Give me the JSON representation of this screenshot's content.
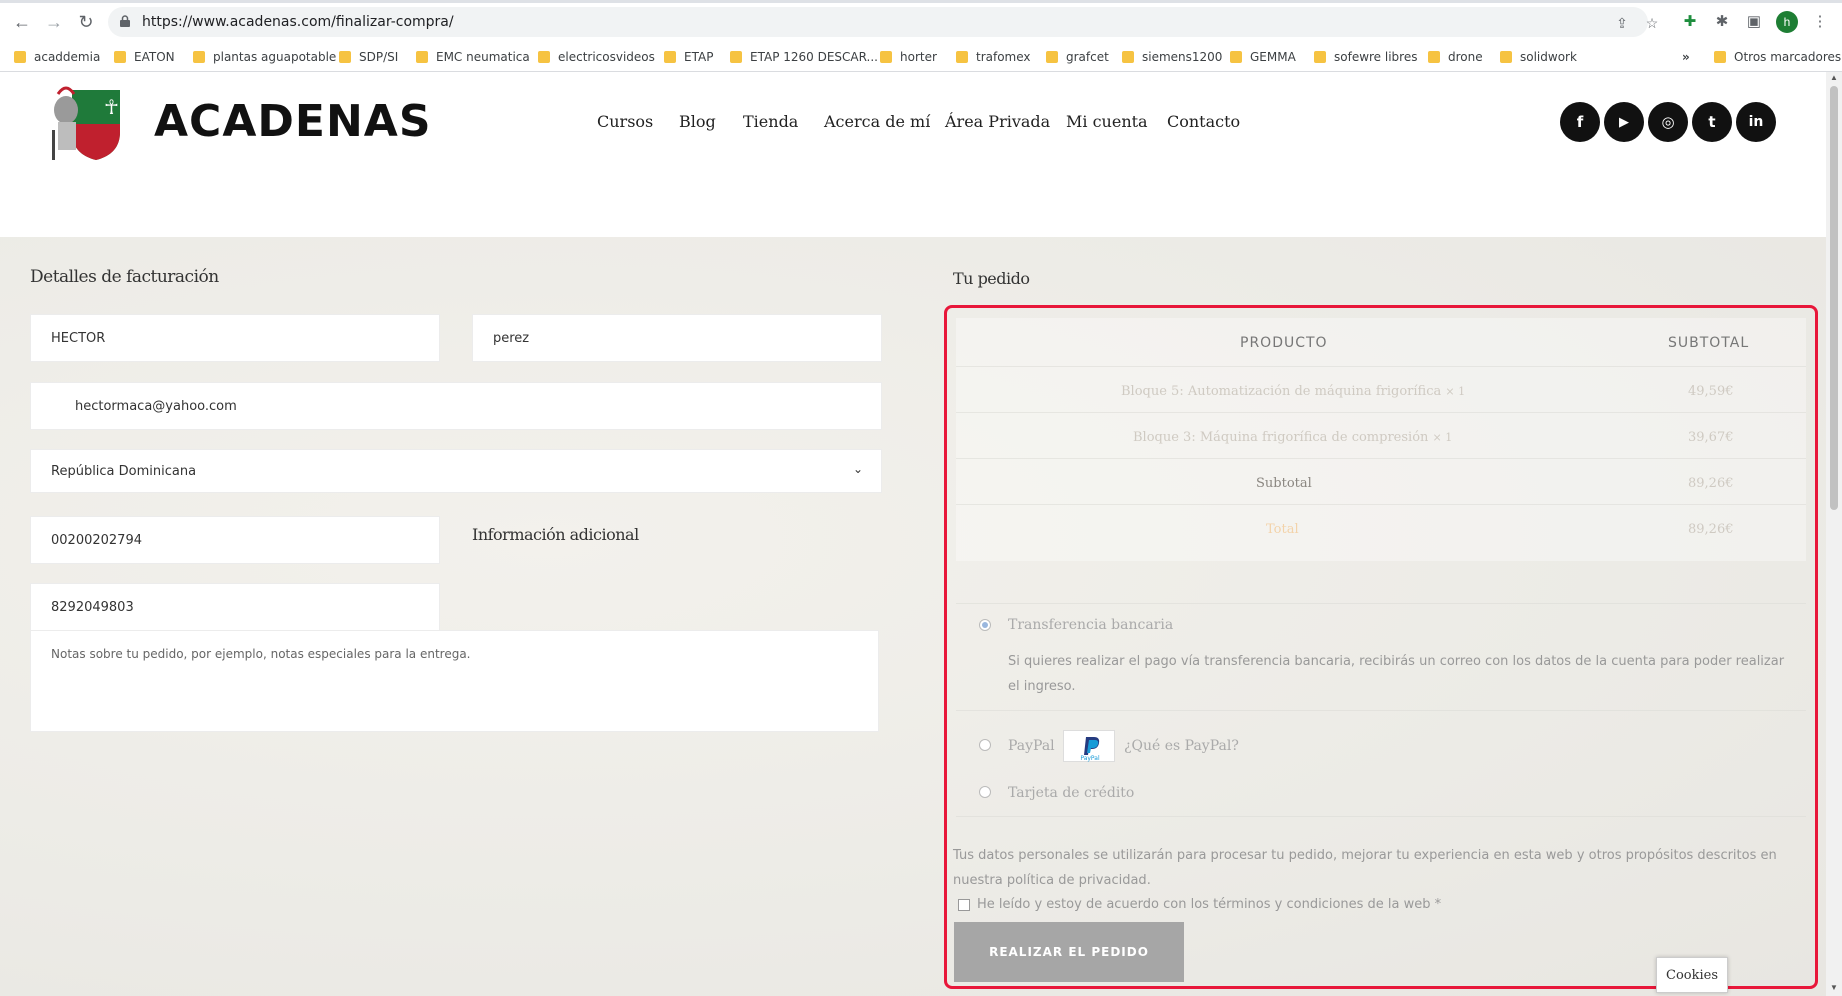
{
  "browser": {
    "url": "https://www.acadenas.com/finalizar-compra/",
    "profile_initial": "h",
    "bookmarks": [
      "acaddemia",
      "EATON",
      "plantas aguapotable",
      "SDP/SI",
      "EMC neumatica",
      "electricosvideos",
      "ETAP",
      "ETAP 1260 DESCAR...",
      "horter",
      "trafomex",
      "grafcet",
      "siemens1200",
      "GEMMA",
      "sofewre libres",
      "drone",
      "solidwork"
    ],
    "bookmarks_more": "»",
    "other_bookmarks": "Otros marcadores"
  },
  "site": {
    "brand": "ACADENAS",
    "menu": [
      "Cursos",
      "Blog",
      "Tienda",
      "Acerca de mí",
      "Área Privada",
      "Mi cuenta",
      "Contacto"
    ],
    "social": [
      "f",
      "▶",
      "◎",
      "t",
      "in"
    ]
  },
  "billing": {
    "title": "Detalles de facturación",
    "first_name": "HECTOR",
    "last_name": "perez",
    "email": "hectormaca@yahoo.com",
    "country": "República Dominicana",
    "field_a": "00200202794",
    "field_b": "8292049803",
    "additional_title": "Información adicional",
    "notes_placeholder": "Notas sobre tu pedido, por ejemplo, notas especiales para la entrega."
  },
  "order": {
    "title": "Tu pedido",
    "col_product": "PRODUCTO",
    "col_subtotal": "SUBTOTAL",
    "items": [
      {
        "name": "Bloque 5: Automatización de máquina frigorífica",
        "qty": "× 1",
        "price": "49,59€"
      },
      {
        "name": "Bloque 3: Máquina frigorífica de compresión",
        "qty": "× 1",
        "price": "39,67€"
      }
    ],
    "subtotal_label": "Subtotal",
    "subtotal_value": "89,26€",
    "total_label": "Total",
    "total_value": "89,26€"
  },
  "payment": {
    "bank_label": "Transferencia bancaria",
    "bank_desc": "Si quieres realizar el pago vía transferencia bancaria, recibirás un correo con los datos de la cuenta para poder realizar el ingreso.",
    "paypal_label": "PayPal",
    "paypal_badge": "PayPal",
    "paypal_link": "¿Qué es PayPal?",
    "card_label": "Tarjeta de crédito",
    "privacy_text": "Tus datos personales se utilizarán para procesar tu pedido, mejorar tu experiencia en esta web y otros propósitos descritos en nuestra",
    "privacy_link": "política de privacidad",
    "terms_text": "He leído y estoy de acuerdo con los términos y condiciones de la web",
    "terms_required": "*",
    "place_order": "REALIZAR EL PEDIDO"
  },
  "cookies": "Cookies",
  "colors": {
    "highlight": "#e8173a",
    "button": "#a6a6a6"
  }
}
